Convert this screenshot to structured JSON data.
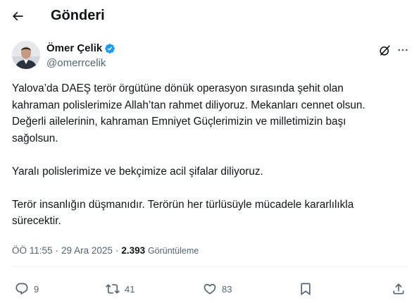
{
  "topbar": {
    "back_icon": "arrow-left-icon",
    "title": "Gönderi"
  },
  "author": {
    "name": "Ömer Çelik",
    "handle": "@omerrcelik",
    "verified_icon": "verified-badge-icon",
    "verified_color": "#1d9bf0"
  },
  "header_actions": {
    "grok_icon": "grok-icon",
    "more_icon": "more-horizontal-icon"
  },
  "tweet": {
    "paragraphs": [
      "Yalova’da DAEŞ terör örgütüne dönük operasyon sırasında şehit olan\nkahraman polislerimize Allah’tan rahmet diliyoruz. Mekanları cennet olsun.\nDeğerli ailelerinin, kahraman Emniyet Güçlerimizin ve milletimizin başı\nsağolsun.",
      "Yaralı polislerimize ve bekçimize acil şifalar diliyoruz.",
      "Terör insanlığın düşmanıdır. Terörün her türlüsüyle mücadele kararlılıkla\nsürecektir."
    ]
  },
  "meta": {
    "time": "ÖÖ 11:55",
    "separator": "·",
    "date": "29 Ara 2025",
    "views_count": "2.393",
    "views_label": "Görüntüleme"
  },
  "actions": {
    "reply": {
      "icon": "reply-icon",
      "count": "9"
    },
    "repost": {
      "icon": "repost-icon",
      "count": "41"
    },
    "like": {
      "icon": "like-icon",
      "count": "83"
    },
    "bookmark": {
      "icon": "bookmark-icon"
    },
    "share": {
      "icon": "share-icon"
    }
  },
  "colors": {
    "text_primary": "#0f1419",
    "text_secondary": "#536471",
    "accent": "#1d9bf0",
    "divider": "#eff3f4"
  }
}
